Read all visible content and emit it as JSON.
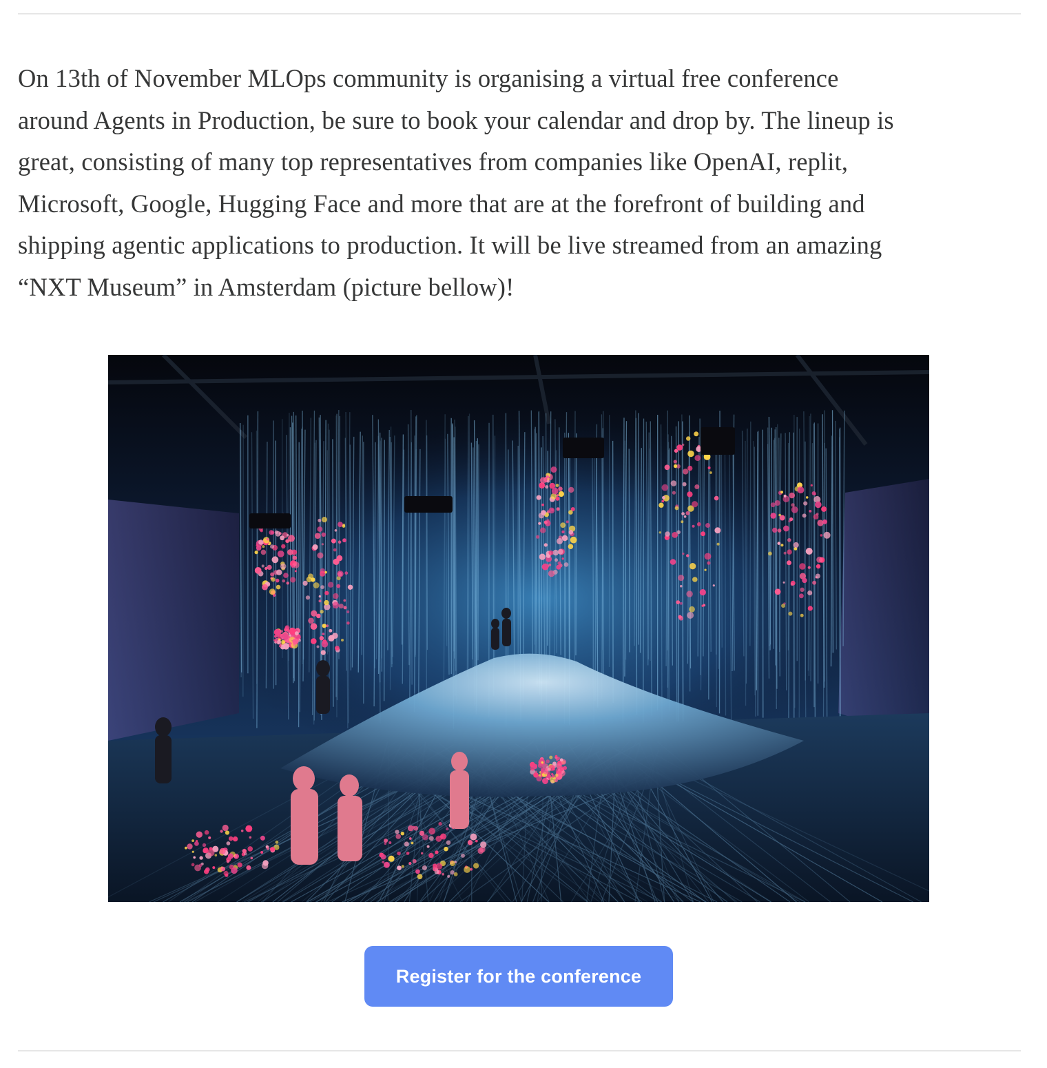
{
  "article": {
    "paragraph_lines": [
      "On 13th of November MLOps community is organising a virtual free conference",
      "around Agents in Production, be sure to book your calendar and drop by. The lineup is",
      "great, consisting of many top representatives from companies like OpenAI, replit,",
      "Microsoft, Google, Hugging Face and more that are at the forefront of building and",
      "shipping agentic applications to production. It will be live streamed from an amazing",
      "“NXT Museum” in Amsterdam (picture bellow)!"
    ]
  },
  "figure": {
    "subject": "immersive digital art installation with projected light waterfalls and flowers"
  },
  "cta": {
    "register_label": "Register for the conference"
  },
  "colors": {
    "text": "#363737",
    "button": "#608af4",
    "button_text": "#ffffff",
    "divider": "#e6e6e6"
  }
}
